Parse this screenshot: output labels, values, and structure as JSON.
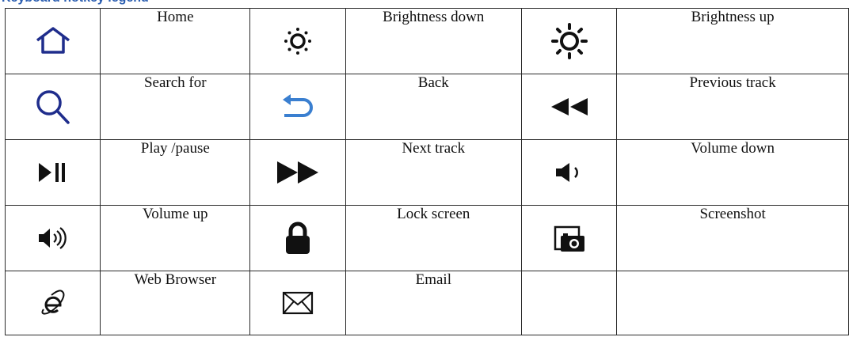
{
  "heading": "Keyboard hotkey legend",
  "rows": [
    [
      {
        "icon": "home-icon",
        "label": "Home"
      },
      {
        "icon": "brightness-down-icon",
        "label": "Brightness down"
      },
      {
        "icon": "brightness-up-icon",
        "label": "Brightness up"
      }
    ],
    [
      {
        "icon": "search-icon",
        "label": "Search for"
      },
      {
        "icon": "back-icon",
        "label": "Back"
      },
      {
        "icon": "previous-track-icon",
        "label": "Previous track"
      }
    ],
    [
      {
        "icon": "play-pause-icon",
        "label": "Play /pause"
      },
      {
        "icon": "next-track-icon",
        "label": "Next track"
      },
      {
        "icon": "volume-down-icon",
        "label": "Volume down"
      }
    ],
    [
      {
        "icon": "volume-up-icon",
        "label": "Volume up"
      },
      {
        "icon": "lock-icon",
        "label": "Lock screen"
      },
      {
        "icon": "screenshot-icon",
        "label": "Screenshot"
      }
    ],
    [
      {
        "icon": "web-browser-icon",
        "label": "Web Browser"
      },
      {
        "icon": "email-icon",
        "label": "Email"
      },
      {
        "icon": "",
        "label": ""
      }
    ]
  ],
  "colors": {
    "heading": "#2a5db0",
    "icon_blue": "#1f2d8c",
    "back_blue": "#3a7fd0",
    "icon_black": "#111111"
  }
}
